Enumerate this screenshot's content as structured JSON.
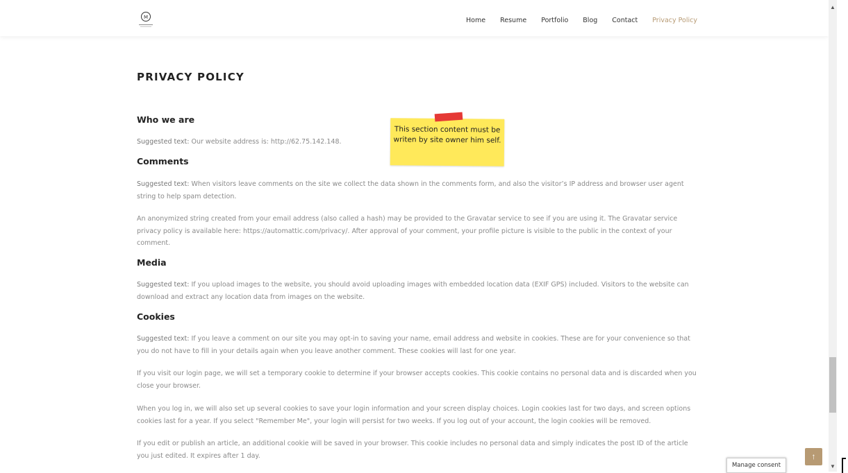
{
  "header": {
    "nav": [
      "Home",
      "Resume",
      "Portfolio",
      "Blog",
      "Contact",
      "Privacy Policy"
    ],
    "active_index": 5
  },
  "page": {
    "title": "PRIVACY POLICY"
  },
  "sticky_note": {
    "text": "This section content must be writen by site owner him self."
  },
  "sections": {
    "who_we_are": {
      "heading": "Who we are",
      "p1_lead": "Suggested text:",
      "p1_text": " Our website address is: http://62.75.142.148."
    },
    "comments": {
      "heading": "Comments",
      "p1_lead": "Suggested text:",
      "p1_text": " When visitors leave comments on the site we collect the data shown in the comments form, and also the visitor’s IP address and browser user agent string to help spam detection.",
      "p2": "An anonymized string created from your email address (also called a hash) may be provided to the Gravatar service to see if you are using it. The Gravatar service privacy policy is available here: https://automattic.com/privacy/. After approval of your comment, your profile picture is visible to the public in the context of your comment."
    },
    "media": {
      "heading": "Media",
      "p1_lead": "Suggested text:",
      "p1_text": " If you upload images to the website, you should avoid uploading images with embedded location data (EXIF GPS) included. Visitors to the website can download and extract any location data from images on the website."
    },
    "cookies": {
      "heading": "Cookies",
      "p1_lead": "Suggested text:",
      "p1_text": " If you leave a comment on our site you may opt-in to saving your name, email address and website in cookies. These are for your convenience so that you do not have to fill in your details again when you leave another comment. These cookies will last for one year.",
      "p2": "If you visit our login page, we will set a temporary cookie to determine if your browser accepts cookies. This cookie contains no personal data and is discarded when you close your browser.",
      "p3": "When you log in, we will also set up several cookies to save your login information and your screen display choices. Login cookies last for two days, and screen options cookies last for a year. If you select \"Remember Me\", your login will persist for two weeks. If you log out of your account, the login cookies will be removed.",
      "p4": "If you edit or publish an article, an additional cookie will be saved in your browser. This cookie includes no personal data and simply indicates the post ID of the article you just edited. It expires after 1 day."
    }
  },
  "widgets": {
    "consent_label": "Manage consent",
    "back_to_top_icon": "arrow-up-icon"
  },
  "colors": {
    "accent": "#b79a73",
    "note_yellow": "#ffe95a",
    "tape_red": "#e53935"
  }
}
